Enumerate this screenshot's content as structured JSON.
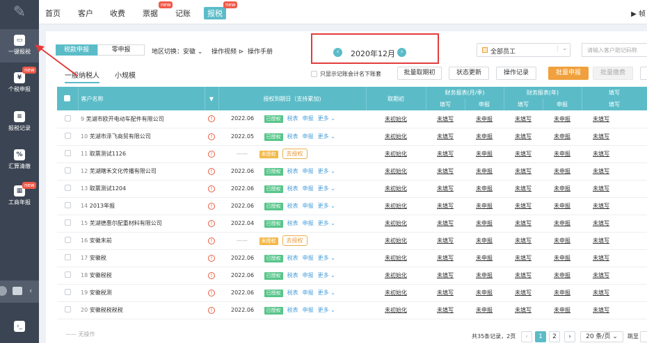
{
  "sidebar": {
    "items": [
      {
        "label": "一键报税",
        "badge": ""
      },
      {
        "label": "个税申报",
        "badge": "new"
      },
      {
        "label": "报税记录",
        "badge": ""
      },
      {
        "label": "汇算清缴",
        "badge": ""
      },
      {
        "label": "工商年报",
        "badge": "new"
      }
    ]
  },
  "topnav": {
    "items": [
      "首页",
      "客户",
      "收费",
      "票据",
      "记账",
      "报税"
    ],
    "badge": "new",
    "right_text": "帧"
  },
  "toolbar": {
    "tabs": [
      "税款申报",
      "零申报"
    ],
    "region_label": "地区切换：",
    "region_value": "安徽",
    "video": "操作视频",
    "manual": "操作手册",
    "period": "2020年12月",
    "staff": "全部员工",
    "search_placeholder": "请输入客户助记码称"
  },
  "subtabs": [
    "一般纳税人",
    "小规模"
  ],
  "filter_label": "只显示记账会计名下账套",
  "actions": [
    "批量取期初",
    "状态更新",
    "操作记录",
    "批量申报",
    "批量缴费"
  ],
  "columns": {
    "name": "客户名称",
    "deadline": "授权到期日（支持累加)",
    "init": "取期初",
    "month": "财务报表(月/季)",
    "year": "财务报表(年)",
    "fill": "填写",
    "declare": "申报"
  },
  "row_actions": {
    "tax": "税表",
    "declare": "申报",
    "more": "更多",
    "go_auth": "去授权",
    "init_text": "未初始化",
    "unfilled": "未填写",
    "undeclared": "未申报",
    "dash": "——"
  },
  "rows": [
    {
      "no": "9",
      "name": "芜湖市欧开电动车配件有限公司",
      "date": "2022.06",
      "status": "已授权"
    },
    {
      "no": "10",
      "name": "芜湖市泽飞商贸有限公司",
      "date": "2022.05",
      "status": "已授权"
    },
    {
      "no": "11",
      "name": "取票测试1126",
      "date": "",
      "status": "未授权"
    },
    {
      "no": "12",
      "name": "芜湖瞎禾文化传播有限公司",
      "date": "2022.06",
      "status": "已授权"
    },
    {
      "no": "13",
      "name": "取票测试1204",
      "date": "2022.06",
      "status": "已授权"
    },
    {
      "no": "14",
      "name": "2013年报",
      "date": "2022.06",
      "status": "已授权"
    },
    {
      "no": "15",
      "name": "芜湖德惠尔配重材料有限公司",
      "date": "2022.04",
      "status": "已授权"
    },
    {
      "no": "16",
      "name": "安徽末前",
      "date": "",
      "status": "未授权"
    },
    {
      "no": "17",
      "name": "安徽税",
      "date": "2022.06",
      "status": "已授权"
    },
    {
      "no": "18",
      "name": "安徽税税",
      "date": "2022.06",
      "status": "已授权"
    },
    {
      "no": "19",
      "name": "安徽税测",
      "date": "2022.06",
      "status": "已授权"
    },
    {
      "no": "20",
      "name": "安徽税税税税",
      "date": "2022.06",
      "status": "已授权"
    }
  ],
  "footer": {
    "no_op": "无操作",
    "summary": "共35条记录，2页",
    "pages": [
      "1",
      "2"
    ],
    "page_size": "20 条/页",
    "jump": "跳至"
  },
  "colors": {
    "accent": "#5bbcc8",
    "orange": "#f0a03c",
    "warn": "#e8593c"
  }
}
